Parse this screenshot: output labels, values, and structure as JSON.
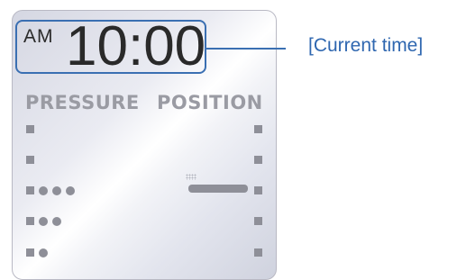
{
  "clock": {
    "ampm": "AM",
    "time": "10:00"
  },
  "callout": {
    "label": "[Current time]"
  },
  "labels": {
    "pressure": "PRESSURE",
    "position": "POSITION"
  },
  "pressure_indicator": {
    "rows": 5,
    "dots_per_row_from_top": [
      0,
      0,
      3,
      2,
      1
    ]
  },
  "position_indicator": {
    "rows": 5,
    "bar_row": 3
  },
  "colors": {
    "callout": "#3a6fb2",
    "indicator": "#8e8f98",
    "label": "#9a9ba3"
  }
}
